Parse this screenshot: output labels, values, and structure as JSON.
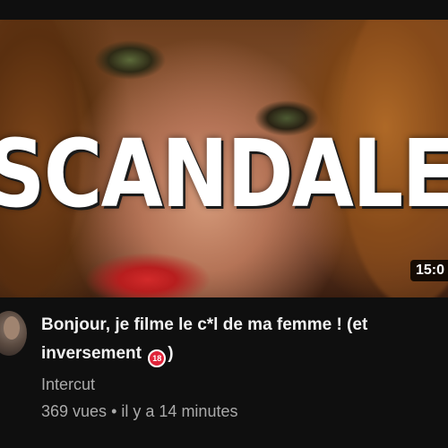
{
  "video": {
    "overlay_text": "SCANDALE",
    "duration": "15:0",
    "title_part1": "Bonjour, je filme le c*l de ma femme ! (et inversement",
    "title_badge": "18",
    "title_part2": ")",
    "channel": "Intercut",
    "views": "369 vues",
    "separator": "•",
    "age": "il y a 14 minutes"
  },
  "colors": {
    "background": "#0f0f0f",
    "title": "#f1f1f1",
    "secondary_text": "#aaaaaa",
    "badge": "#e0243a"
  },
  "icons": {
    "badge": "under-18-prohibited-icon"
  }
}
